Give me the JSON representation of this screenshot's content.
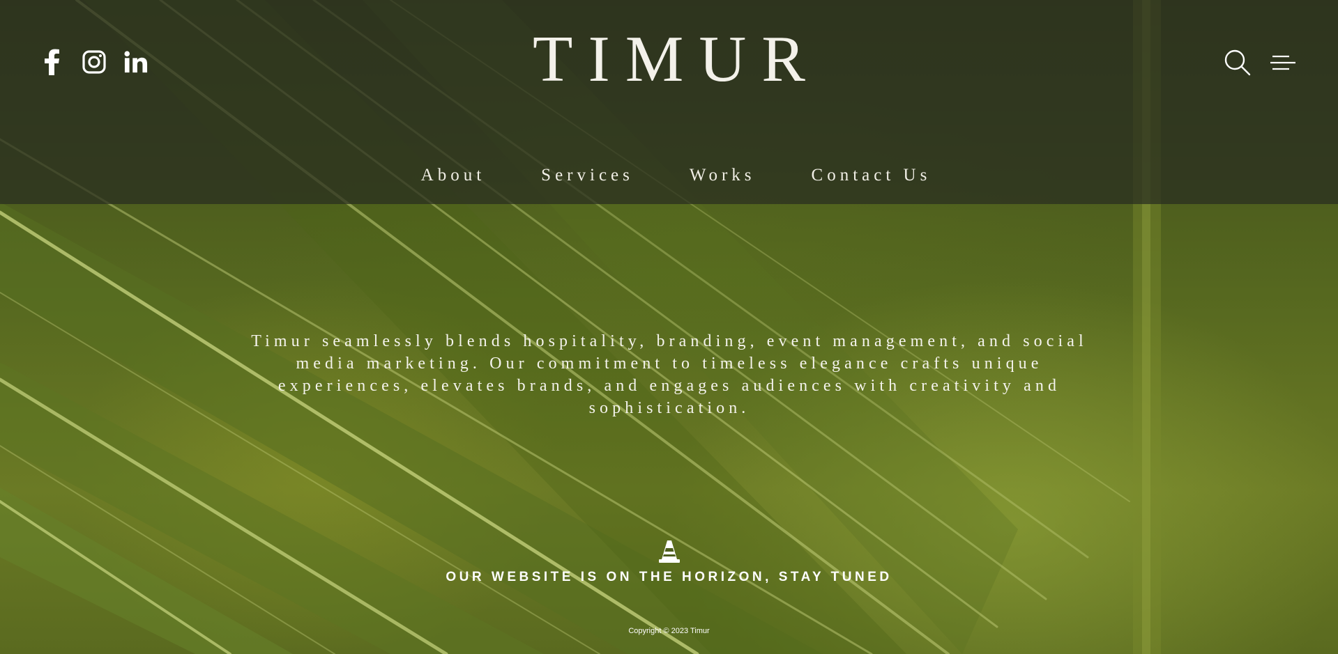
{
  "brand": {
    "logo_text": "TIMUR"
  },
  "social": {
    "items": [
      {
        "icon": "facebook-icon",
        "label": "Facebook"
      },
      {
        "icon": "instagram-icon",
        "label": "Instagram"
      },
      {
        "icon": "linkedin-icon",
        "label": "LinkedIn"
      }
    ]
  },
  "tools": {
    "search_icon": "search-icon",
    "menu_icon": "hamburger-menu-icon"
  },
  "nav": {
    "items": [
      {
        "label": "About"
      },
      {
        "label": "Services"
      },
      {
        "label": "Works"
      },
      {
        "label": "Contact Us"
      }
    ]
  },
  "main": {
    "intro": "Timur seamlessly blends hospitality, branding, event management, and social media marketing. Our commitment to timeless elegance crafts unique experiences, elevates brands, and engages audiences with creativity and sophistication.",
    "horizon_icon": "traffic-cone-icon",
    "horizon_text": "OUR WEBSITE IS ON THE HORIZON, STAY TUNED"
  },
  "footer": {
    "copyright": "Copyright © 2023 Timur"
  },
  "colors": {
    "text": "#ffffff",
    "header_overlay": "#2c2f24",
    "leaf": "#6b7d23"
  }
}
